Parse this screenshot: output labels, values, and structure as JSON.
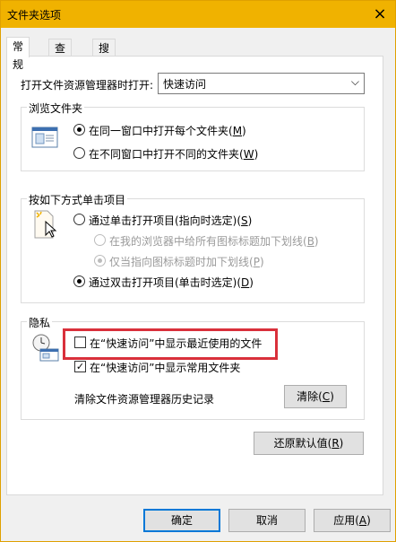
{
  "window": {
    "title": "文件夹选项",
    "close_glyph": "×"
  },
  "tabs": [
    {
      "label": "常规",
      "active": true
    },
    {
      "label": "查看"
    },
    {
      "label": "搜索"
    }
  ],
  "open_explorer": {
    "label": "打开文件资源管理器时打开:",
    "value": "快速访问",
    "arrow": "⌵"
  },
  "browse": {
    "title": "浏览文件夹",
    "option1": {
      "text": "在同一窗口中打开每个文件夹(",
      "key": "M",
      "end": ")"
    },
    "option2": {
      "text": "在不同窗口中打开不同的文件夹(",
      "key": "W",
      "end": ")"
    }
  },
  "click": {
    "title": "按如下方式单击项目",
    "single": {
      "text": "通过单击打开项目(指向时选定)(",
      "key": "S",
      "end": ")"
    },
    "sub1": {
      "text": "在我的浏览器中给所有图标标题加下划线(",
      "key": "B",
      "end": ")"
    },
    "sub2": {
      "text": "仅当指向图标标题时加下划线(",
      "key": "P",
      "end": ")"
    },
    "double": {
      "text": "通过双击打开项目(单击时选定)(",
      "key": "D",
      "end": ")"
    }
  },
  "privacy": {
    "title": "隐私",
    "recent_files": "在“快速访问”中显示最近使用的文件",
    "frequent_folders": "在“快速访问”中显示常用文件夹",
    "check_mark": "✓",
    "clear_history_label": "清除文件资源管理器历史记录",
    "clear_button": {
      "text": "清除(",
      "key": "C",
      "end": ")"
    }
  },
  "restore_defaults": {
    "text": "还原默认值(",
    "key": "R",
    "end": ")"
  },
  "buttons": {
    "ok": "确定",
    "cancel": "取消",
    "apply": {
      "text": "应用(",
      "key": "A",
      "end": ")"
    }
  },
  "accent_color": "#f0b200"
}
